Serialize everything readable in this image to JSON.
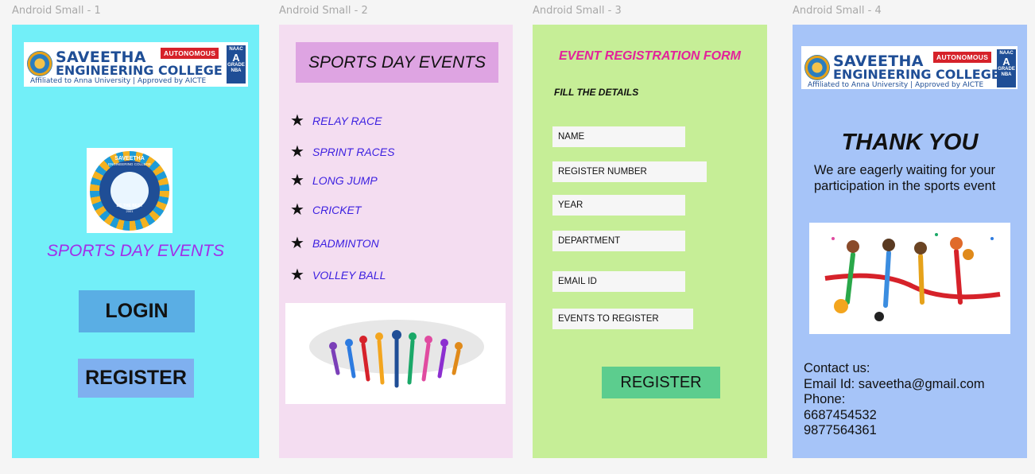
{
  "frames": [
    {
      "label": "Android Small - 1"
    },
    {
      "label": "Android Small - 2"
    },
    {
      "label": "Android Small - 3"
    },
    {
      "label": "Android Small - 4"
    }
  ],
  "college_logo": {
    "name_line1": "SAVEETHA",
    "name_line2": "ENGINEERING COLLEGE",
    "affiliation": "Affiliated to Anna University | Approved by AICTE",
    "badge": "AUTONOMOUS",
    "naac": "NAAC",
    "naac_grade": "A",
    "naac_sub": "GRADE",
    "nba": "NBA"
  },
  "emblem": {
    "name": "SAVEETHA",
    "sub": "ENGINEERING COLLEGE",
    "motto": "BE THE BEST",
    "year": "2001"
  },
  "screen1": {
    "title": "SPORTS DAY EVENTS",
    "login_label": "LOGIN",
    "register_label": "REGISTER"
  },
  "screen2": {
    "header": "SPORTS DAY EVENTS",
    "events": [
      "RELAY RACE",
      "SPRINT RACES",
      "LONG JUMP",
      "CRICKET",
      "BADMINTON",
      "VOLLEY BALL"
    ],
    "star": "★"
  },
  "screen3": {
    "title": "EVENT REGISTRATION FORM",
    "subtitle": "FILL THE DETAILS",
    "fields": [
      "NAME",
      "REGISTER NUMBER",
      "YEAR",
      "DEPARTMENT",
      "EMAIL ID",
      "EVENTS TO REGISTER"
    ],
    "register_label": "REGISTER"
  },
  "screen4": {
    "title": "THANK YOU",
    "message": "We are eagerly waiting for your participation in the sports event",
    "contact_heading": "Contact us:",
    "email": "Email Id: saveetha@gmail.com",
    "phone_label": "Phone:",
    "phone1": "6687454532",
    "phone2": "9877564361"
  },
  "colors": {
    "screen1_bg": "#72eff8",
    "screen2_bg": "#f4ddf1",
    "screen3_bg": "#c6ee97",
    "screen4_bg": "#a6c4f8",
    "event_text": "#3b1fe0",
    "form_title": "#e3229a",
    "sports_title": "#a22ee8"
  }
}
